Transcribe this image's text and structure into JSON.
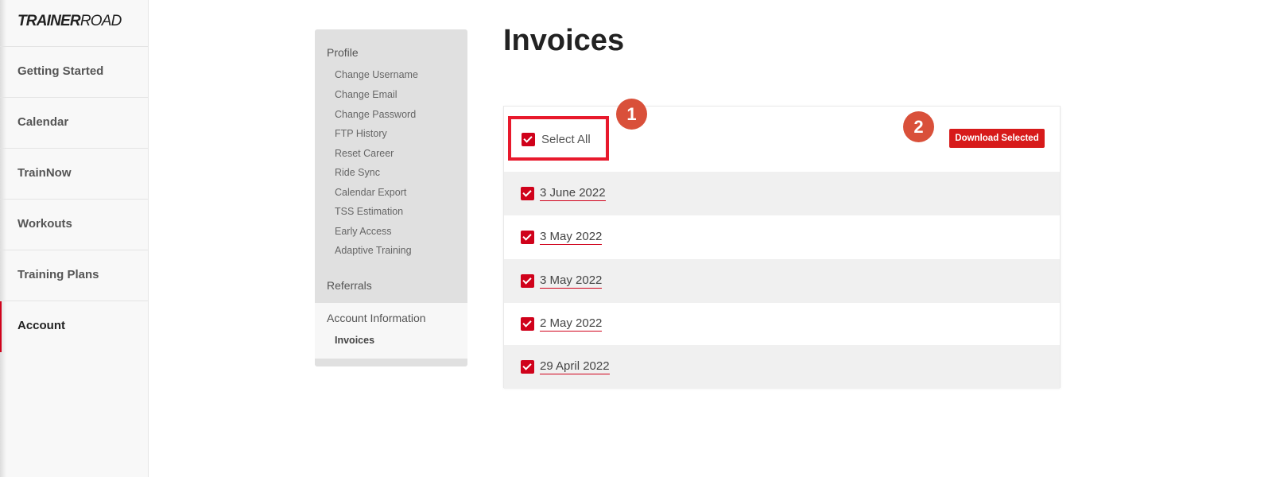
{
  "brand": {
    "bold": "TRAINER",
    "light": "ROAD"
  },
  "nav": {
    "items": [
      {
        "label": "Getting Started"
      },
      {
        "label": "Calendar"
      },
      {
        "label": "TrainNow"
      },
      {
        "label": "Workouts"
      },
      {
        "label": "Training Plans"
      },
      {
        "label": "Account",
        "active": true
      }
    ]
  },
  "sidebar": {
    "profile": "Profile",
    "profile_items": [
      "Change Username",
      "Change Email",
      "Change Password",
      "FTP History",
      "Reset Career",
      "Ride Sync",
      "Calendar Export",
      "TSS Estimation",
      "Early Access",
      "Adaptive Training"
    ],
    "referrals": "Referrals",
    "account_info": "Account Information",
    "invoices": "Invoices"
  },
  "main": {
    "title": "Invoices",
    "select_all": "Select All",
    "download_button": "Download Selected",
    "invoices": [
      {
        "date": "3 June 2022",
        "checked": true
      },
      {
        "date": "3 May 2022",
        "checked": true
      },
      {
        "date": "3 May 2022",
        "checked": true
      },
      {
        "date": "2 May 2022",
        "checked": true
      },
      {
        "date": "29 April 2022",
        "checked": true
      }
    ]
  },
  "annotations": {
    "badge1": "1",
    "badge2": "2"
  },
  "colors": {
    "accent": "#d0021b",
    "badge": "#d9503a",
    "highlight": "#e8192c"
  }
}
